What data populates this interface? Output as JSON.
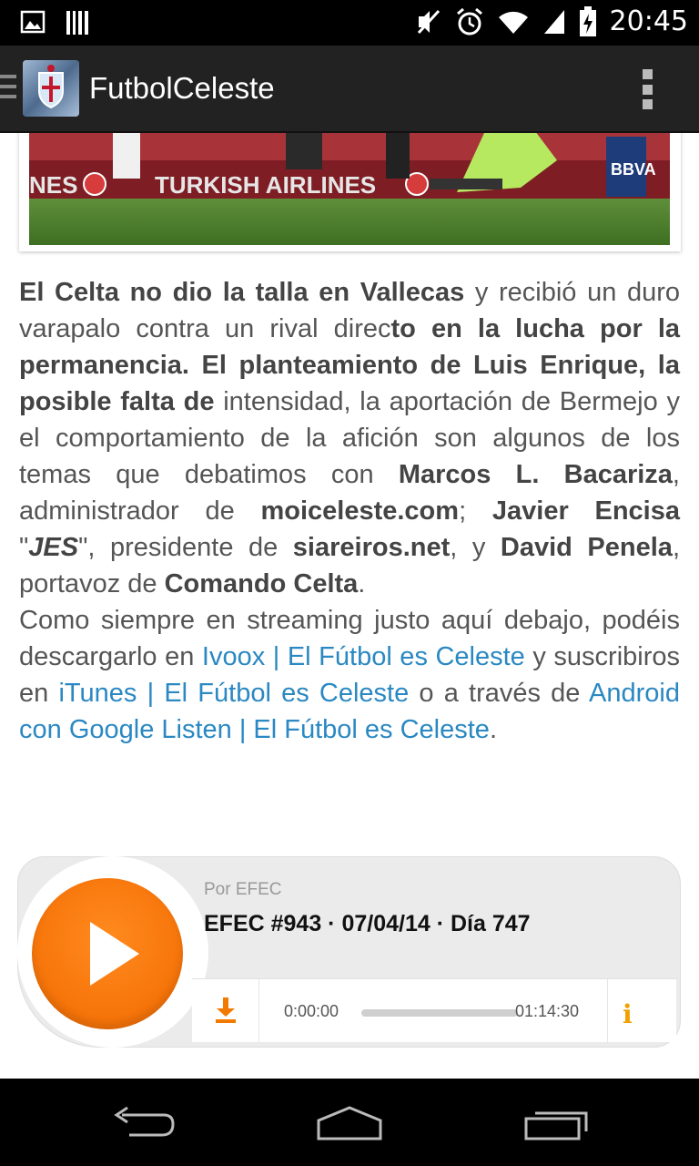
{
  "status_bar": {
    "time": "20:45",
    "icons": [
      "gallery-notification-icon",
      "barcode-notification-icon",
      "mute-icon",
      "alarm-icon",
      "wifi-icon",
      "signal-icon",
      "battery-charging-icon"
    ]
  },
  "action_bar": {
    "title": "FutbolCeleste",
    "menu_icon": "overflow-menu-icon"
  },
  "article": {
    "p1": [
      {
        "t": "El Celta no dio la talla en Vallecas",
        "b": true
      },
      {
        "t": " y recibió un duro varapalo contra un rival direc"
      },
      {
        "t": "to en la lucha por la permanencia. El planteamiento de Luis Enrique, la posible falta de",
        "b": true
      },
      {
        "t": " intensidad, la aportación de Bermejo y el comportamiento de la afición son algunos de los temas que debatimos con "
      },
      {
        "t": "Marcos L. Bacariza",
        "b": true
      },
      {
        "t": ", administrador de "
      },
      {
        "t": "moiceleste.com",
        "b": true
      },
      {
        "t": "; "
      },
      {
        "t": "Javier Encisa",
        "b": true
      },
      {
        "t": " \""
      },
      {
        "t": "JES",
        "b": true,
        "i": true
      },
      {
        "t": "\", presidente de "
      },
      {
        "t": "siareiros.net",
        "b": true
      },
      {
        "t": ", y "
      },
      {
        "t": "David Penela",
        "b": true
      },
      {
        "t": ", portavoz de "
      },
      {
        "t": "Comando Celta",
        "b": true
      },
      {
        "t": "."
      }
    ],
    "p2": [
      {
        "t": "Como siempre en streaming justo aquí debajo, podéis descargarlo en "
      },
      {
        "t": "Ivoox | El Fútbol es Celeste",
        "link": true
      },
      {
        "t": " y suscribiros en "
      },
      {
        "t": "iTunes | El Fútbol es Celeste",
        "link": true
      },
      {
        "t": " o a través de "
      },
      {
        "t": "Android con Google Listen | El Fútbol es Celeste",
        "link": true
      },
      {
        "t": "."
      }
    ]
  },
  "player": {
    "by_line": "Por EFEC",
    "episode_title": "EFEC #943 · 07/04/14 · Día 747",
    "time_start": "0:00:00",
    "time_end": "01:14:30",
    "progress": 0.0,
    "accent_color": "#f27a00"
  },
  "nav_bar": {
    "buttons": [
      "back-icon",
      "home-icon",
      "recent-apps-icon"
    ]
  }
}
